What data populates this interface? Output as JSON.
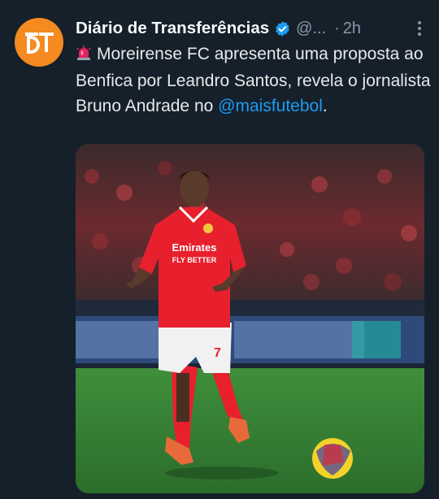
{
  "tweet": {
    "author_name": "Diário de Transferências",
    "handle": "@...",
    "separator": "·",
    "time": "2h",
    "emoji": "🚨",
    "text_main": "Moreirense FC apresenta uma proposta ao Benfica por Leandro Santos, revela o jornalista Bruno Andrade no",
    "mention": "@maisfutebol",
    "text_end": ".",
    "avatar_logo_text": "DT",
    "image": {
      "description_icon": "photo-football-player",
      "shirt_sponsor_line1": "Emirates",
      "shirt_sponsor_line2": "FLY BETTER",
      "shirt_number": "7"
    }
  },
  "colors": {
    "background": "#15202b",
    "text": "#e7e9ea",
    "muted": "#8b98a5",
    "link": "#1d9bf0",
    "verified": "#1d9bf0",
    "avatar": "#f48a20"
  }
}
